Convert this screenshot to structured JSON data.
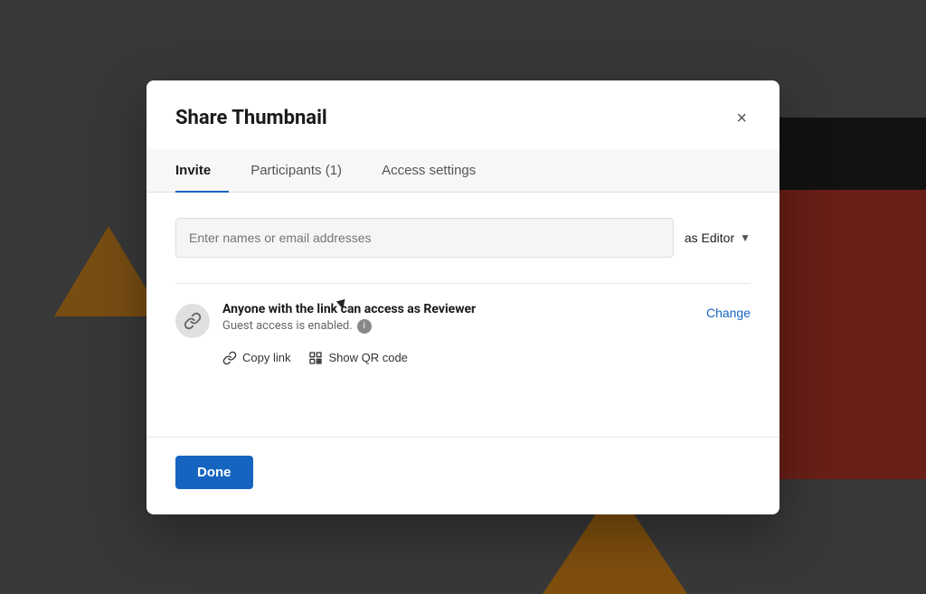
{
  "background": {
    "overlay_color": "rgba(0,0,0,0.45)"
  },
  "modal": {
    "title": "Share Thumbnail",
    "close_label": "×",
    "tabs": [
      {
        "id": "invite",
        "label": "Invite",
        "active": true
      },
      {
        "id": "participants",
        "label": "Participants (1)",
        "active": false
      },
      {
        "id": "access_settings",
        "label": "Access settings",
        "active": false
      }
    ],
    "invite": {
      "input_placeholder": "Enter names or email addresses",
      "role_label": "as Editor",
      "dropdown_arrow": "▼"
    },
    "link_access": {
      "main_text": "Anyone with the link can access as Reviewer",
      "sub_text": "Guest access is enabled.",
      "change_label": "Change",
      "copy_link_label": "Copy link",
      "qr_label": "Show QR code"
    },
    "footer": {
      "done_label": "Done"
    }
  }
}
